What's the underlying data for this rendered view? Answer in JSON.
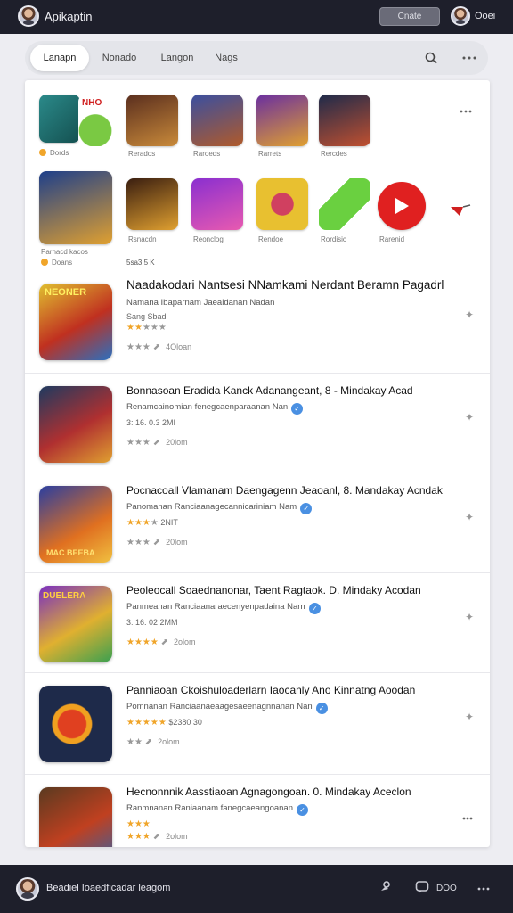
{
  "topbar": {
    "title": "Apikaptin",
    "search_label": "Cnate",
    "user_label": "Ooei"
  },
  "tabs": [
    {
      "label": "Lanapn",
      "active": true
    },
    {
      "label": "Nonado"
    },
    {
      "label": "Langon"
    },
    {
      "label": "Nags"
    }
  ],
  "tab_icons": {
    "search": "search-icon",
    "more": "more-icon"
  },
  "featured_grid": {
    "row1": [
      {
        "label": "Dords",
        "badge": "NHO",
        "colors": [
          "#2b8a8a",
          "#7ac943"
        ],
        "coin": true
      },
      {
        "label": "Rerados",
        "colors": [
          "#5a2e1e",
          "#c98a3a"
        ]
      },
      {
        "label": "Raroeds",
        "colors": [
          "#3a4fa0",
          "#b05a2a"
        ]
      },
      {
        "label": "Rarrets",
        "colors": [
          "#6a2fa0",
          "#e0a030"
        ]
      },
      {
        "label": "Rercdes",
        "colors": [
          "#1e2a4a",
          "#c05030"
        ]
      }
    ],
    "row2": [
      {
        "label": "Parnacd kacos",
        "sublabel": "Doans",
        "colors": [
          "#1e3f8a",
          "#e0a030"
        ],
        "coin": true
      },
      {
        "label": "Rsnacdn",
        "colors": [
          "#3a1e10",
          "#e0a030"
        ]
      },
      {
        "label": "Reonclog",
        "colors": [
          "#8a2fd0",
          "#e85ab0"
        ]
      },
      {
        "label": "Rendoe",
        "colors": [
          "#e8c030",
          "#d04060"
        ]
      },
      {
        "label": "Rordisic",
        "colors": [
          "#ffffff",
          "#6ad040"
        ]
      },
      {
        "label": "Rarenid",
        "colors": [
          "#ffffff",
          "#e02020"
        ]
      },
      {
        "label": "",
        "colors": [
          "#ffffff",
          "#d02020"
        ]
      }
    ],
    "row2_extra": "5sa3 5 K"
  },
  "apps": [
    {
      "icon_text": "NEONER",
      "title": "Naadakodari Nantsesi NNamkami Nerdant Beramn Pagadrl",
      "subtitle": "Namana Ibaparnam Jaealdanan Nadan",
      "meta": "Sang Sbadi",
      "stars": 2,
      "rating_text": "",
      "size": "4Oloan",
      "verified": false,
      "colors": [
        "#e0c030",
        "#c03020",
        "#2a70c0"
      ]
    },
    {
      "icon_text": "",
      "title": "Bonnasoan Eradida Kanck Adanangeant, 8 - Mindakay Acad",
      "subtitle": "Renamcainomian fenegcaenparaanan Nan",
      "meta": "3: 16. 0.3 2MI",
      "stars": 0,
      "rating_text": "",
      "size": "20lom",
      "verified": true,
      "colors": [
        "#1e3a60",
        "#b03030",
        "#e0a030"
      ]
    },
    {
      "icon_text": "MAC BEEBA",
      "title": "Pocnacoall Vlamanam Daengagenn Jeaoanl, 8. Mandakay Acndak",
      "subtitle": "Panomanan Ranciaanagecannicariniam Nam",
      "meta": "",
      "stars": 3,
      "rating_text": "2NIT",
      "size": "20lom",
      "verified": true,
      "colors": [
        "#2a3ea0",
        "#e07020",
        "#f0c040"
      ]
    },
    {
      "icon_text": "DUELERA",
      "title": "Peoleocall Soaednanonar, Taent Ragtaok. D. Mindaky Acodan",
      "subtitle": "Panmeanan Ranciaanaraecenyenpadaina Narn",
      "meta": "3: 16. 02 2MM",
      "stars": 4,
      "rating_text": "",
      "size": "2olom",
      "verified": true,
      "colors": [
        "#7a2fc0",
        "#e0b030",
        "#3aa050"
      ]
    },
    {
      "icon_text": "",
      "title": "Panniaoan Ckoishuloaderlarn Iaocanly Ano Kinnatng Aoodan",
      "subtitle": "Pomnanan Ranciaanaeaagesaeenagnnanan Nan",
      "meta": "",
      "stars": 5,
      "rating_text": "$2380 30",
      "size": "2olom",
      "verified": true,
      "colors": [
        "#1e2a4a",
        "#e04020",
        "#f0a020"
      ]
    },
    {
      "icon_text": "",
      "title": "Hecnonnnik Aasstiaoan Agnagongoan. 0. Mindakay Aceclon",
      "subtitle": "Ranmnanan Raniaanam fanegcaeangoanan",
      "meta": "",
      "stars": 3,
      "rating_text": "",
      "size": "2olom",
      "verified": true,
      "colors": [
        "#5a3a20",
        "#c04020",
        "#3a60a0"
      ]
    }
  ],
  "bottombar": {
    "text": "Beadiel Ioaedficadar leagom",
    "count": "DOO"
  },
  "colors": {
    "bar_bg": "#1e1f2b",
    "accent_star": "#f0a52a",
    "verified": "#4a90e2"
  }
}
